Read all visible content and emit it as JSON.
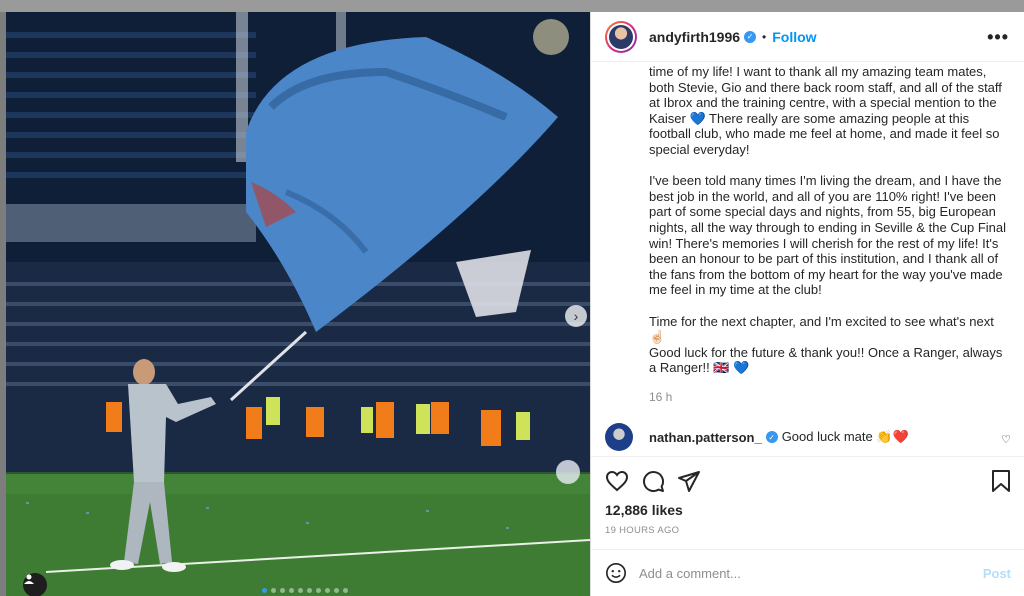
{
  "post": {
    "username": "andyfirth1996",
    "verified_icon": "verified-badge-icon",
    "separator": "•",
    "follow_label": "Follow",
    "more_label": "•••",
    "caption_paragraphs": [
      "time of my life! I want to thank all my amazing team mates, both Stevie, Gio and there back room staff, and all of the staff at Ibrox and the training centre, with a special mention to the Kaiser 💙 There really are some amazing people at this football club, who made me feel at home, and made it feel so special everyday!",
      "I've been told many times I'm living the dream, and I have the best job in the world, and all of you are 110% right! I've been part of some special days and nights, from 55, big European nights, all the way through to ending in Seville & the Cup Final win! There's memories I will cherish for the rest of my life! It's been an honour to be part of this institution, and I thank all of the fans from the bottom of my heart for the way you've made me feel in my time at the club!",
      "Time for the next chapter, and I'm excited to see what's next ☝🏻\nGood luck for the future & thank you!! Once a Ranger, always a Ranger!! 🇬🇧 💙"
    ],
    "caption_age": "16 h",
    "comment": {
      "username": "nathan.patterson_",
      "text": "Good luck mate 👏❤️"
    },
    "likes": "12,886 likes",
    "posted_ago": "19 HOURS AGO",
    "add_comment_placeholder": "Add a comment...",
    "post_label": "Post"
  },
  "media": {
    "carousel_count": 10,
    "carousel_active_index": 0
  },
  "colors": {
    "accent": "#0095f6",
    "text": "#262626",
    "muted": "#8e8e8e",
    "flag": "#4a86c8"
  }
}
